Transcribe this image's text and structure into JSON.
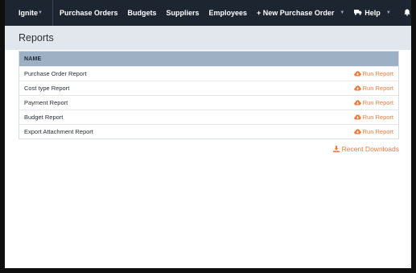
{
  "nav": {
    "brand": "Ignite",
    "links": [
      {
        "label": "Purchase Orders"
      },
      {
        "label": "Budgets"
      },
      {
        "label": "Suppliers"
      },
      {
        "label": "Employees"
      }
    ],
    "new_po": "+ New Purchase Order",
    "help": "Help",
    "icons": [
      "truck-icon",
      "bell-icon",
      "gear-icon"
    ]
  },
  "page": {
    "title": "Reports"
  },
  "table": {
    "header": "NAME",
    "rows": [
      {
        "name": "Purchase Order Report",
        "action": "Run Report"
      },
      {
        "name": "Cost type Report",
        "action": "Run Report"
      },
      {
        "name": "Payment Report",
        "action": "Run Report"
      },
      {
        "name": "Budget Report",
        "action": "Run Report"
      },
      {
        "name": "Export Attachment Report",
        "action": "Run Report"
      }
    ]
  },
  "recent_downloads": "Recent Downloads",
  "colors": {
    "navbar": "#1d2531",
    "accent": "#f07a3c",
    "header_bg": "#e2e7ee",
    "table_head": "#9eb0c4"
  }
}
